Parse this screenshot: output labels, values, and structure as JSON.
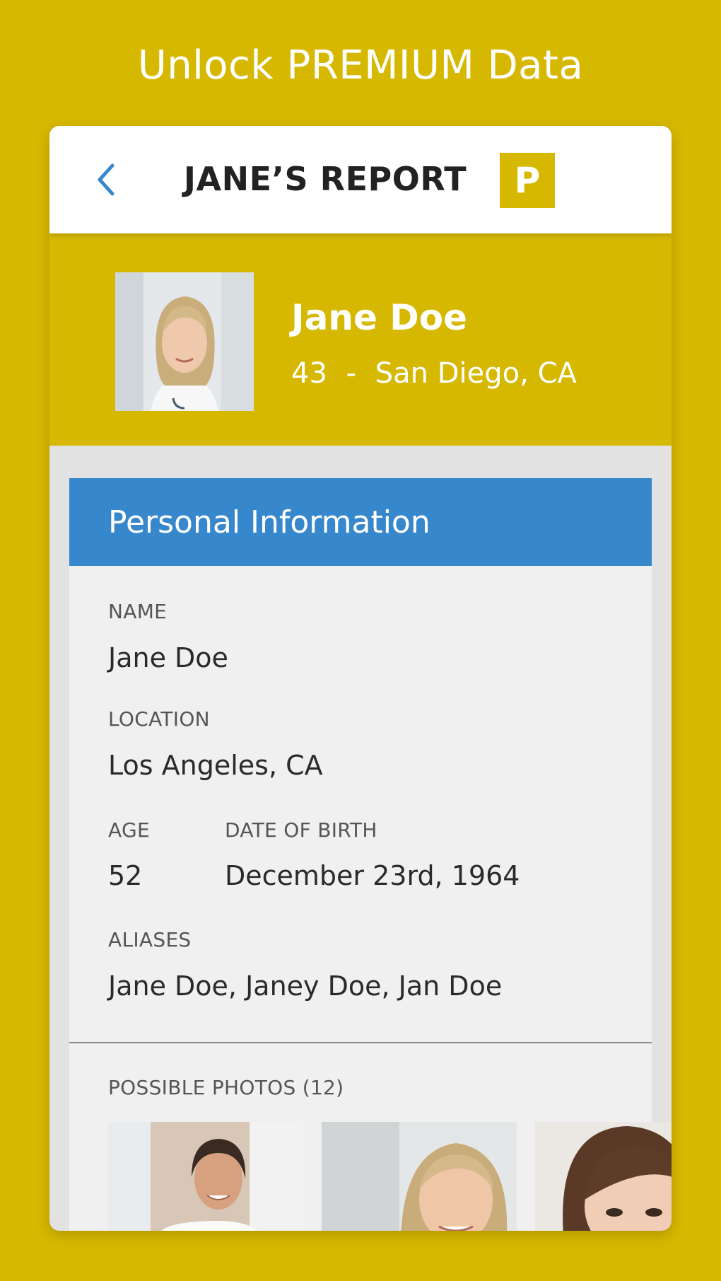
{
  "promo": {
    "title": "Unlock PREMIUM Data"
  },
  "navbar": {
    "back_icon": "chevron-left-icon",
    "title": "JANE’S REPORT",
    "badge": "P"
  },
  "profile": {
    "name": "Jane Doe",
    "age": "43",
    "separator": "-",
    "location": "San Diego, CA"
  },
  "personal_info": {
    "header": "Personal Information",
    "name_label": "NAME",
    "name_value": "Jane Doe",
    "location_label": "LOCATION",
    "location_value": "Los Angeles, CA",
    "age_label": "AGE",
    "age_value": "52",
    "dob_label": "DATE OF BIRTH",
    "dob_value": "December 23rd, 1964",
    "aliases_label": "ALIASES",
    "aliases_value": "Jane Doe, Janey Doe, Jan Doe"
  },
  "photos": {
    "label": "POSSIBLE PHOTOS (12)"
  },
  "colors": {
    "brand_yellow": "#d6b800",
    "header_blue": "#3787cc",
    "back_blue": "#3787cc"
  }
}
